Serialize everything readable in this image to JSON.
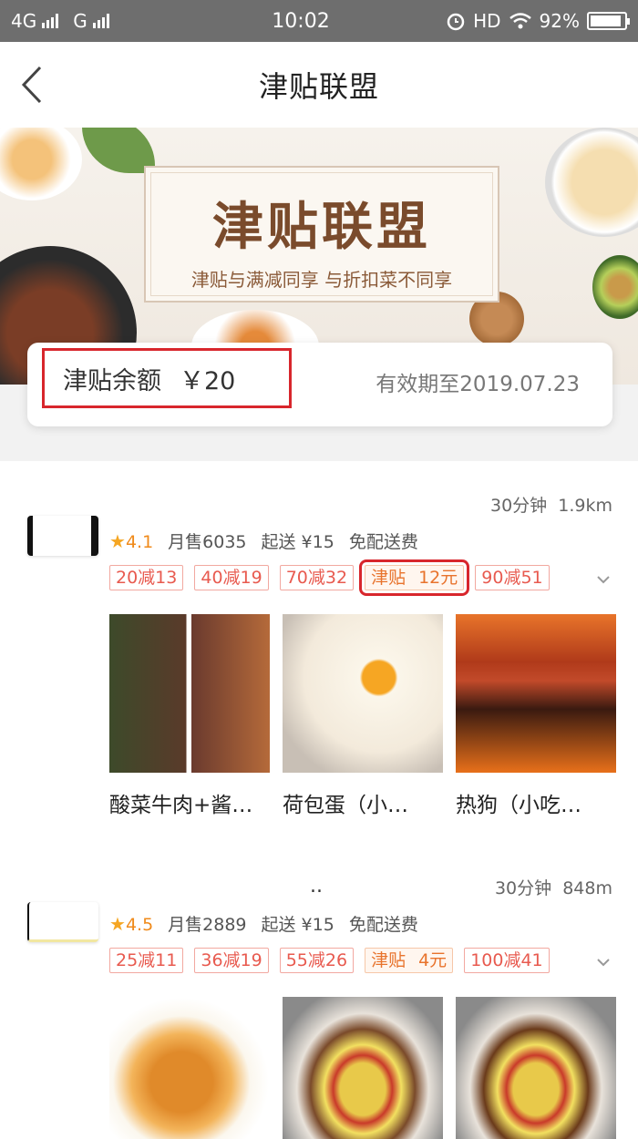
{
  "status_bar": {
    "network1": "4G",
    "network2": "G",
    "time": "10:02",
    "hd": "HD",
    "battery": "92%",
    "battery_level": 0.92
  },
  "nav": {
    "title": "津贴联盟"
  },
  "banner": {
    "title": "津贴联盟",
    "subtitle": "津贴与满减同享 与折扣菜不同享"
  },
  "balance": {
    "label": "津贴余额",
    "amount": "￥20",
    "expiry": "有效期至2019.07.23"
  },
  "shops": [
    {
      "time": "30分钟",
      "distance": "1.9km",
      "rating": "4.1",
      "monthly_sales": "月售6035",
      "min_order": "起送 ¥15",
      "delivery": "免配送费",
      "tags": [
        "20减13",
        "40减19",
        "70减32"
      ],
      "subsidy_label": "津贴",
      "subsidy_value": "12元",
      "tag_after": "90减51",
      "foods": [
        "酸菜牛肉+酱…",
        "荷包蛋（小…",
        "热狗（小吃…"
      ]
    },
    {
      "name_dots": "..",
      "time": "30分钟",
      "distance": "848m",
      "rating": "4.5",
      "monthly_sales": "月售2889",
      "min_order": "起送 ¥15",
      "delivery": "免配送费",
      "tags": [
        "25减11",
        "36减19",
        "55减26"
      ],
      "subsidy_label": "津贴",
      "subsidy_value": "4元",
      "tag_after": "100减41"
    }
  ]
}
